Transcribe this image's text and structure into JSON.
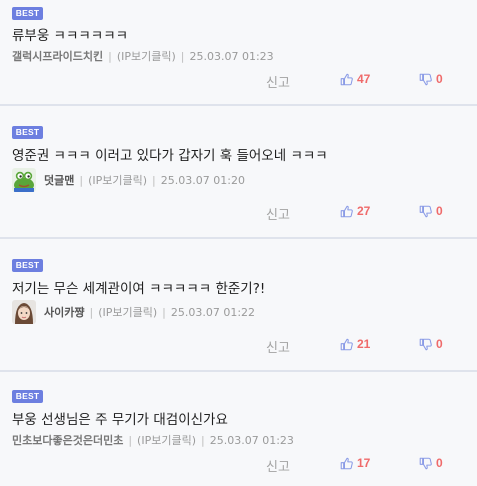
{
  "colors": {
    "badge": "#6d7fe0",
    "count": "#ef6a6a",
    "icon": "#8a9be6",
    "divider": "#dfe3ec"
  },
  "comments": [
    {
      "badge": "BEST",
      "content": "류부웅 ㅋㅋㅋㅋㅋㅋ",
      "author": "갤럭시프라이드치킨",
      "ip": "(IP보기클릭)",
      "time": "25.03.07 01:23",
      "report": "신고",
      "up": "47",
      "down": "0"
    },
    {
      "badge": "BEST",
      "content": "영준권 ㅋㅋㅋ 이러고 있다가 갑자기 훅 들어오네 ㅋㅋㅋ",
      "author": "덧글맨",
      "ip": "(IP보기클릭)",
      "time": "25.03.07 01:20",
      "report": "신고",
      "up": "27",
      "down": "0"
    },
    {
      "badge": "BEST",
      "content": "저기는 무슨 세계관이여 ㅋㅋㅋㅋㅋ 한준기?!",
      "author": "사이카쨩",
      "ip": "(IP보기클릭)",
      "time": "25.03.07 01:22",
      "report": "신고",
      "up": "21",
      "down": "0"
    },
    {
      "badge": "BEST",
      "content": "부웅 선생님은 주 무기가 대검이신가요",
      "author": "민초보다좋은것은더민초",
      "ip": "(IP보기클릭)",
      "time": "25.03.07 01:23",
      "report": "신고",
      "up": "17",
      "down": "0"
    }
  ]
}
